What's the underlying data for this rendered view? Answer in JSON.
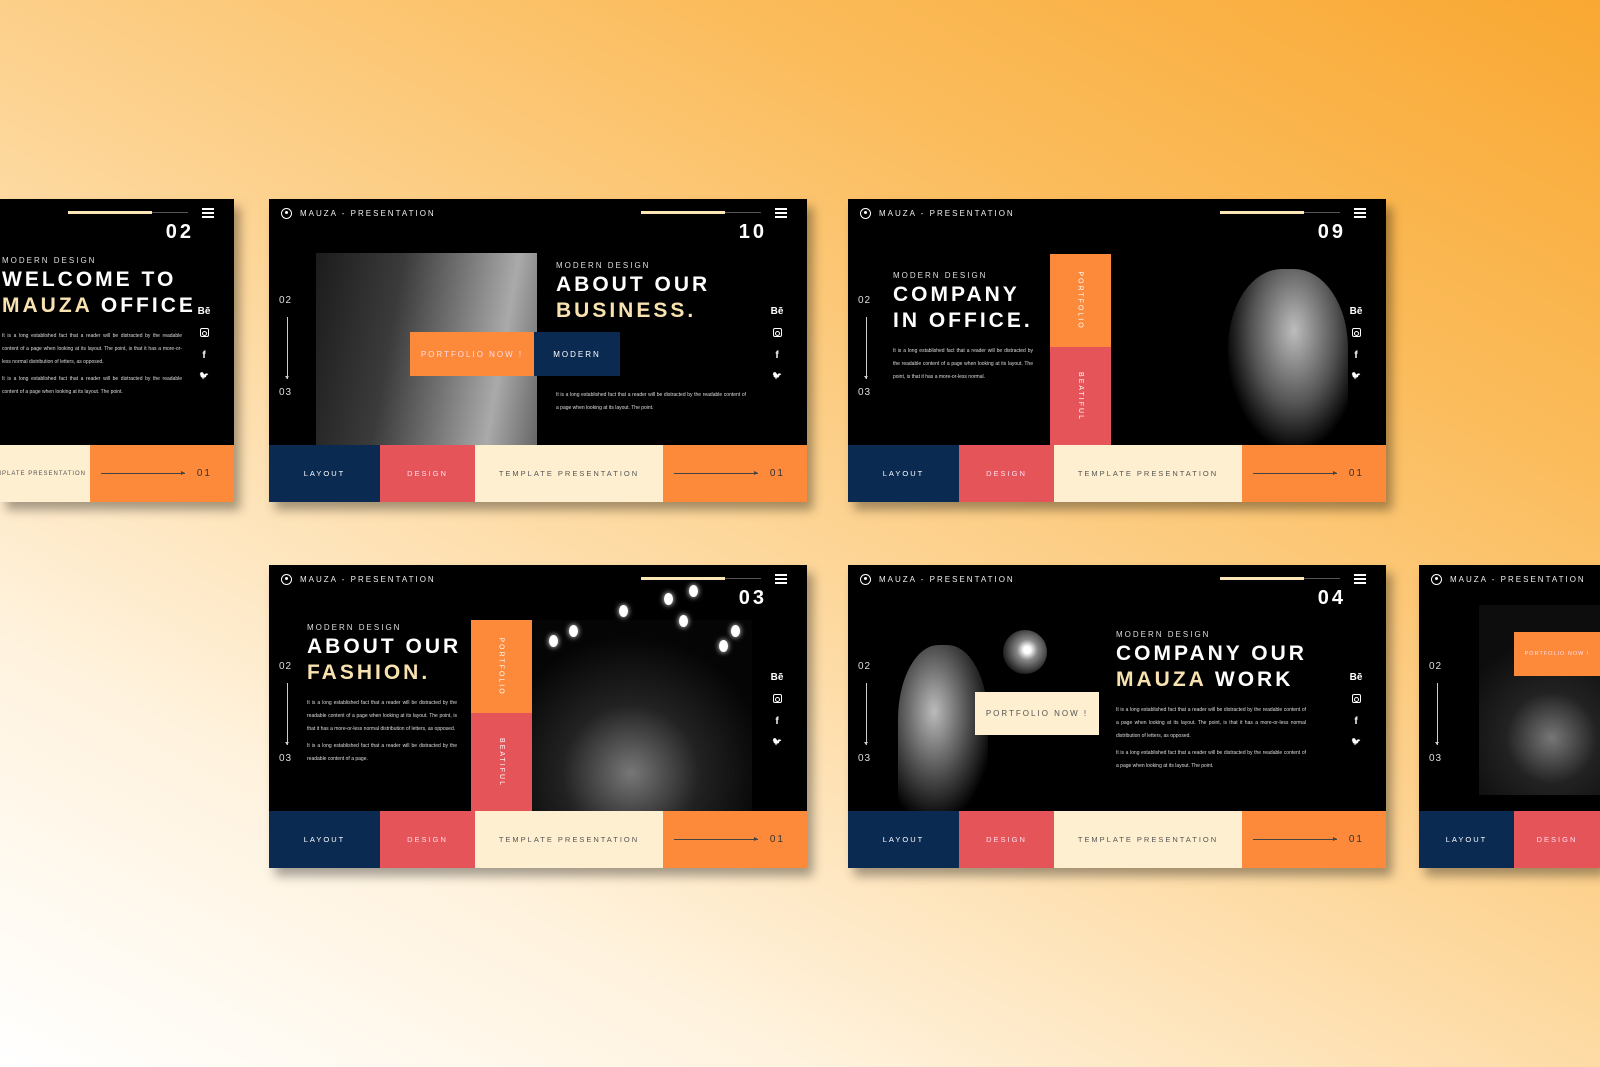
{
  "common": {
    "brand": "MAUZA - PRESENTATION",
    "nav_prev": "02",
    "nav_next": "03",
    "subtitle": "MODERN DESIGN",
    "social": [
      "Bē",
      "instagram-icon",
      "f",
      "twitter-icon"
    ],
    "bottom": {
      "layout": "LAYOUT",
      "design": "DESIGN",
      "template": "TEMPLATE PRESENTATION",
      "page": "01"
    },
    "progress": 0.7,
    "vertical_labels": {
      "portfolio": "PORTFOLIO",
      "beautiful": "BEATIFUL"
    },
    "buttons": {
      "portfolio": "PORTFOLIO NOW !",
      "modern": "MODERN"
    }
  },
  "colors": {
    "navy": "#0b2a52",
    "red": "#e55458",
    "cream": "#fdefd0",
    "orange": "#fd8a3a",
    "highlight": "#f8e2b0",
    "slide_bg": "#000000"
  },
  "slides": [
    {
      "number": "02",
      "title_1": "WELCOME TO",
      "title_2_hl": "MAUZA",
      "title_2_rest": " OFFICE",
      "paragraphs": [
        "It is a long established fact that a reader will be distracted by the readable content of a page when looking at its layout. The point, is that it has a more-or-less normal distribution of letters, as opposed.",
        "It is a long established fact that a reader will be distracted by the readable content of a page when looking at its layout. The point."
      ]
    },
    {
      "number": "10",
      "title_1": "ABOUT OUR",
      "title_2_hl": "BUSINESS.",
      "title_2_rest": "",
      "paragraphs": [
        "It is a long established fact that a reader will be distracted by the readable content of a page when looking at its layout. The point."
      ]
    },
    {
      "number": "09",
      "title_1": "COMPANY",
      "title_2_hl": "",
      "title_2_rest": "IN OFFICE.",
      "paragraphs": [
        "It is a long established fact that a reader will be distracted by the readable content of a page when looking at its layout. The point, is that it has a more-or-less normal."
      ]
    },
    {
      "number": "03",
      "title_1": "ABOUT OUR",
      "title_2_hl": "FASHION.",
      "title_2_rest": "",
      "paragraphs": [
        "It is a long established fact that a reader will be distracted by the readable content of a page when looking at its layout. The point, is that it has a more-or-less normal distribution of letters, as opposed.",
        "It is a long established fact that a reader will be distracted by the readable content of a page."
      ]
    },
    {
      "number": "04",
      "title_1": "COMPANY OUR",
      "title_2_hl": "MAUZA",
      "title_2_rest": " WORK",
      "paragraphs": [
        "It is a long established fact that a reader will be distracted by the readable content of a page when looking at its layout. The point, is that it has a more-or-less normal distribution of letters, as opposed.",
        "It is a long established fact that a reader will be distracted by the readable content of a page when looking at its layout. The point."
      ]
    },
    {
      "number": "",
      "title_1": "",
      "title_2_hl": "",
      "title_2_rest": "",
      "paragraphs": []
    }
  ]
}
